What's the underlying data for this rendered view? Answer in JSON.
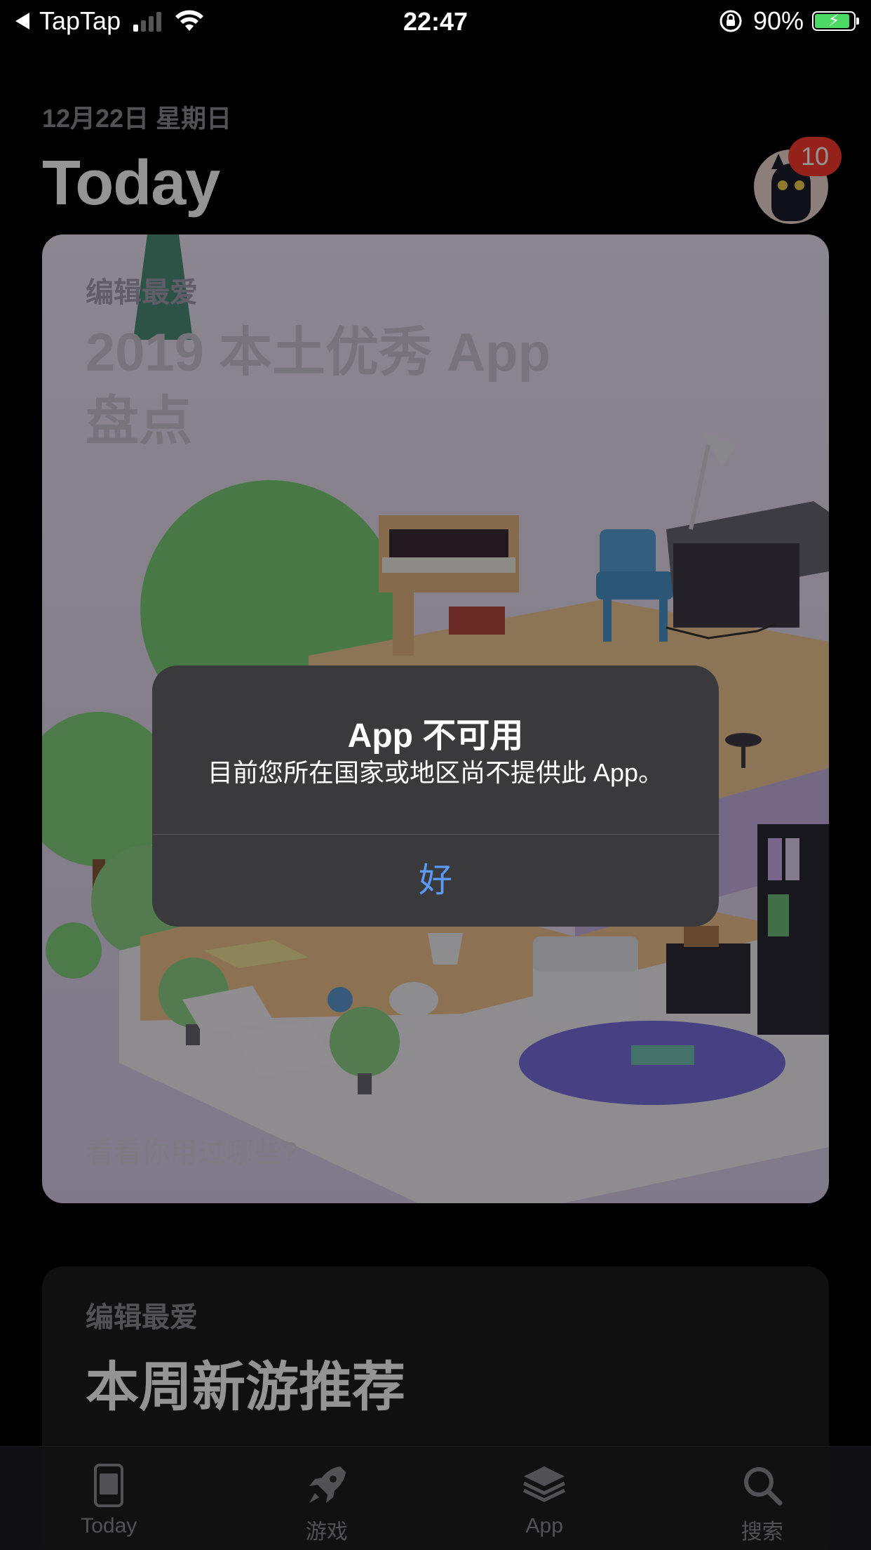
{
  "status_bar": {
    "back_app": "TapTap",
    "time": "22:47",
    "battery_percent": "90%",
    "battery_level": 0.9,
    "signal_bars_active": 1,
    "signal_bars_total": 4
  },
  "header": {
    "date": "12月22日 星期日",
    "title": "Today",
    "notification_count": "10"
  },
  "feature_card": {
    "kicker": "编辑最爱",
    "title": "2019 本土优秀 App\n盘点",
    "footer": "看看你用过哪些?"
  },
  "second_card": {
    "kicker": "编辑最爱",
    "title": "本周新游推荐"
  },
  "alert": {
    "title": "App 不可用",
    "message": "目前您所在国家或地区尚不提供此 App。",
    "button": "好"
  },
  "tab_bar": {
    "tabs": [
      {
        "label": "Today",
        "icon": "today-icon"
      },
      {
        "label": "游戏",
        "icon": "rocket-icon"
      },
      {
        "label": "App",
        "icon": "layers-icon"
      },
      {
        "label": "搜索",
        "icon": "search-icon"
      }
    ]
  },
  "colors": {
    "alert_button": "#5a9bf6",
    "badge": "#ff3b30",
    "battery": "#4cd964"
  }
}
